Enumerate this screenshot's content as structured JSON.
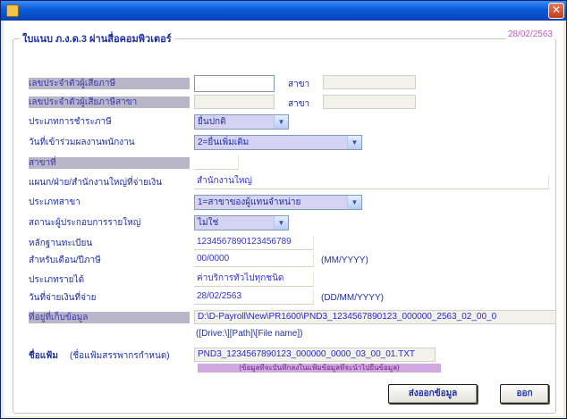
{
  "window": {
    "title": ""
  },
  "group": {
    "title": "ใบแนบ ภ.ง.ด.3 ผ่านสื่อคอมพิวเตอร์",
    "date": "28/02/2563"
  },
  "fields": {
    "tax_id_label": "เลขประจำตัวผู้เสียภาษี",
    "tax_id_value": "",
    "branch_label_1": "สาขา",
    "branch_id_label": "เลขประจำตัวผู้เสียภาษีสาขา",
    "branch_id_value": "",
    "branch_label_2": "สาขา",
    "payment_type_label": "ประเภทการชำระภาษี",
    "payment_type_value": "ยื่นปกติ",
    "filing_type_label": "วันที่เข้าร่วมผลงานพนักงาน",
    "filing_type_value": "2=ยื่นเพิ่มเติม",
    "branch_section_label": "สาขาที่",
    "branch_section_value": "",
    "office_label": "แผนก/ฝ่าย/สำนักงานใหญ่ที่จ่ายเงิน",
    "office_value": "สำนักงานใหญ่",
    "branch_type_label": "ประเภทสาขา",
    "branch_type_value": "1=สาขาของผู้แทนจำหน่าย",
    "hq_status_label": "สถานะผู้ประกอบการรายใหญ่",
    "hq_status_value": "ไม่ใช่",
    "reg_no_label": "หลักฐานทะเบียน",
    "reg_no_value": "1234567890123456789",
    "month_year_label": "สำหรับเดือน/ปีภาษี",
    "month_year_value": "00/0000",
    "month_year_hint": "(MM/YYYY)",
    "income_type_label": "ประเภทรายได้",
    "income_type_value": "ค่าบริการทั่วไปทุกชนิด",
    "pay_date_label": "วันที่จ่ายเงินที่จ่าย",
    "pay_date_value": "28/02/2563",
    "pay_date_hint": "(DD/MM/YYYY)",
    "path_label": "ที่อยู่ที่เก็บข้อมูล",
    "path_value": "D:\\D-Payroll\\New\\PR1600\\PND3_1234567890123_000000_2563_02_00_0",
    "path_hint": "([Drive:\\][Path]\\[File name])",
    "filename_label": "ชื่อแฟ้ม",
    "filename_sub_label": "(ชื่อแฟ้มสรรพากรกำหนด)",
    "filename_value": "PND3_1234567890123_000000_0000_03_00_01.TXT",
    "purple_note": "(ข้อมูลที่จะบันทึกลงในแฟ้มข้อมูลที่จะนำไปยื่นข้อมูล)"
  },
  "buttons": {
    "export_label": "ส่งออกข้อมูล",
    "close_label": "ออก"
  },
  "colors": {
    "titlebar": "#0a5bd8",
    "accent_purple": "#d0a8e0",
    "label_shade": "#b8b6c8"
  }
}
